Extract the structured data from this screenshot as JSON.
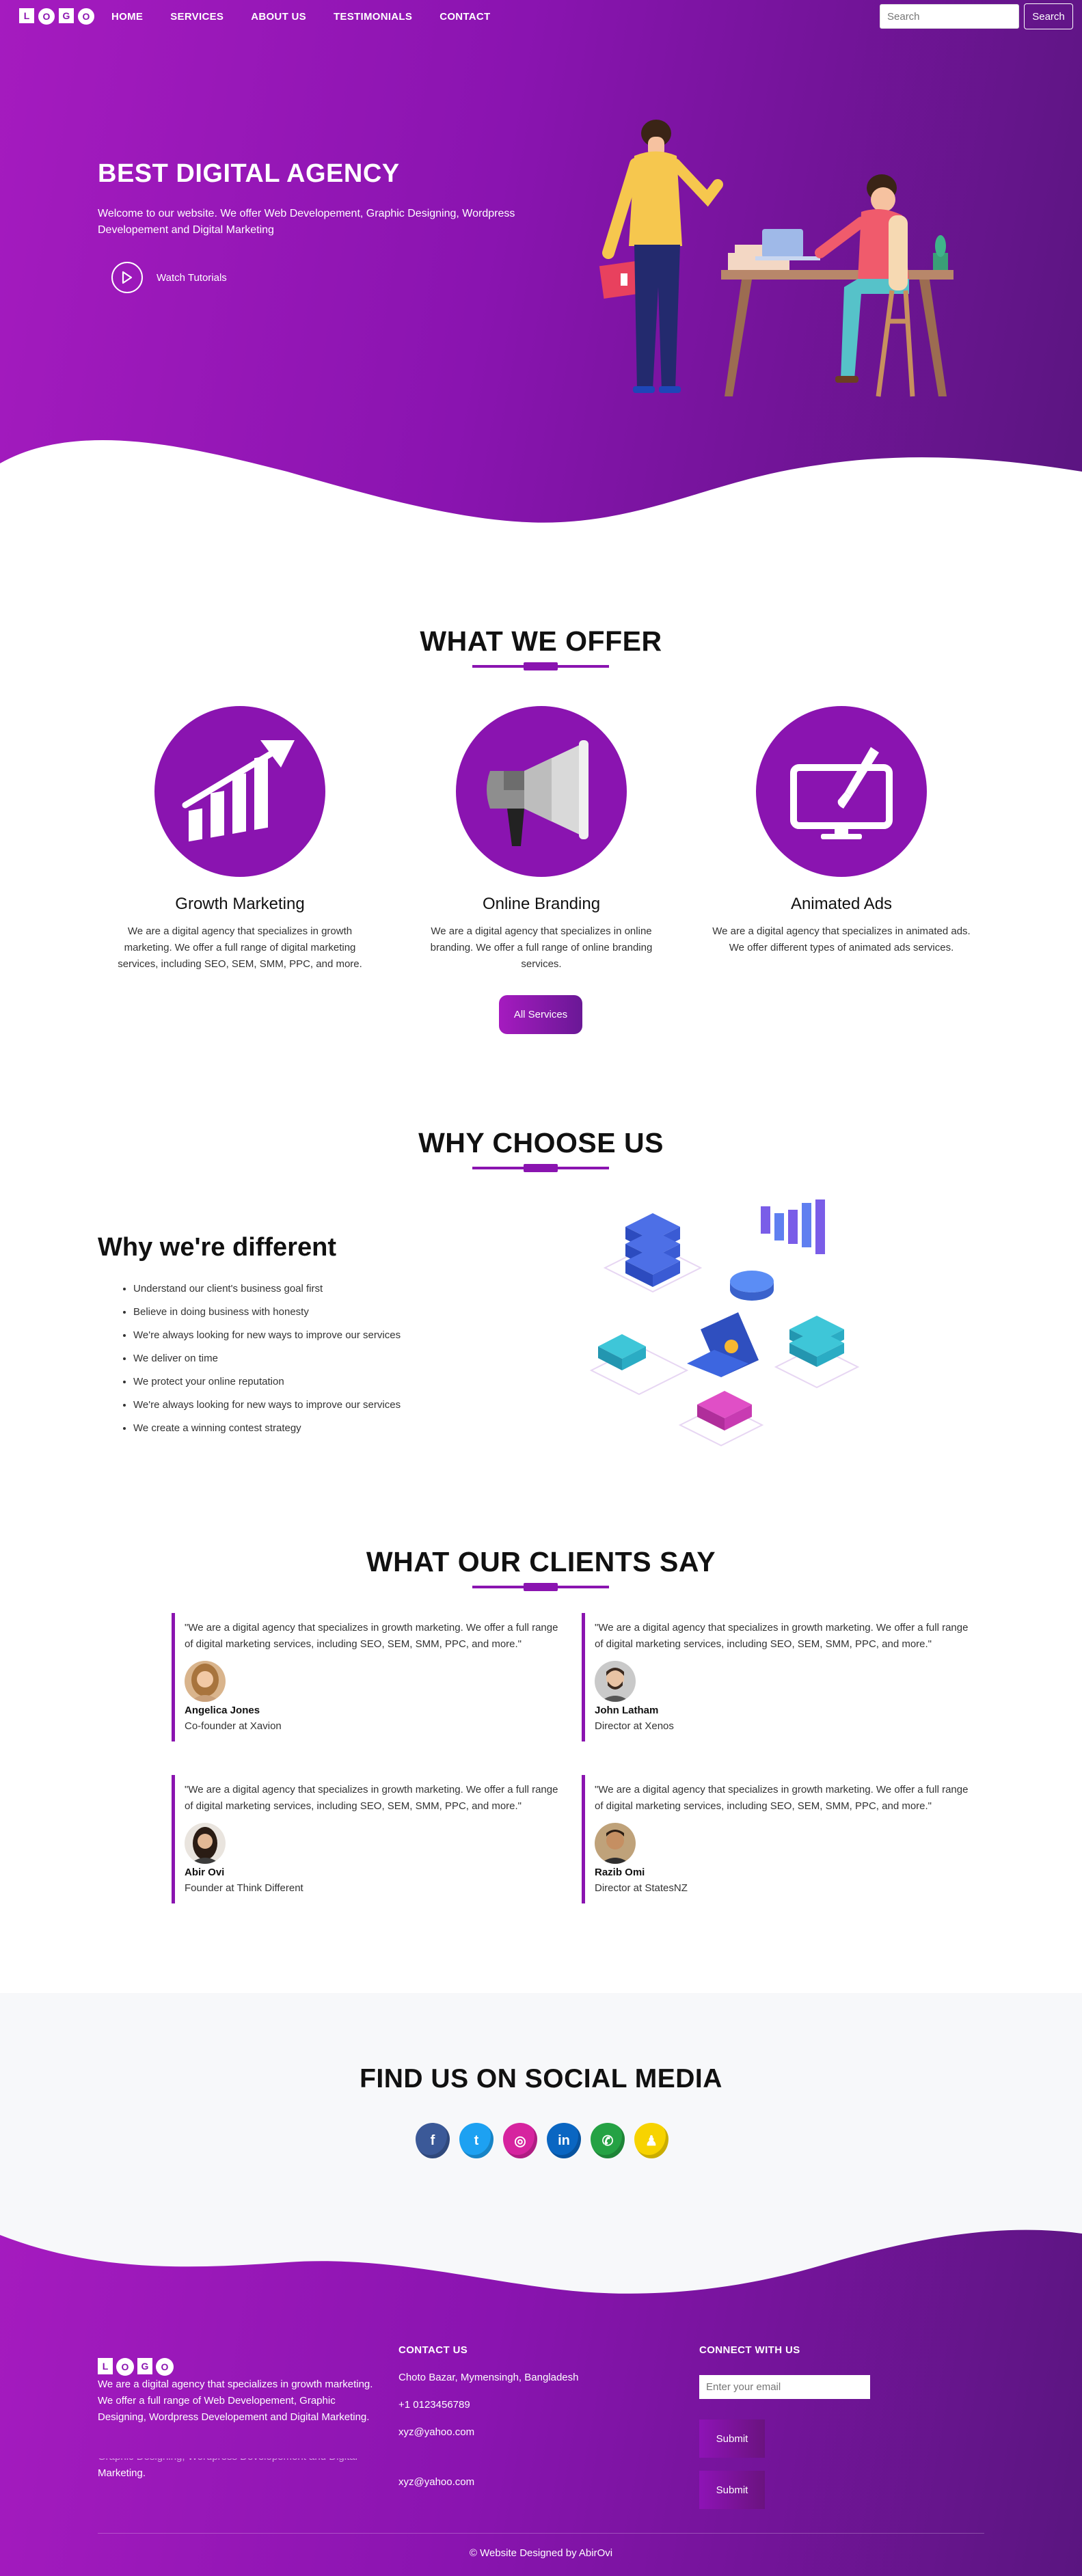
{
  "nav": {
    "logo_letters": [
      "L",
      "O",
      "G",
      "O"
    ],
    "links": [
      "HOME",
      "SERVICES",
      "ABOUT US",
      "TESTIMONIALS",
      "CONTACT"
    ],
    "search_placeholder": "Search",
    "search_button": "Search"
  },
  "hero": {
    "title": "BEST DIGITAL AGENCY",
    "subtitle": "Welcome to our website. We offer Web Developement, Graphic Designing, Wordpress Developement and Digital Marketing",
    "watch_label": "Watch Tutorials"
  },
  "offer": {
    "title": "WHAT WE OFFER",
    "cards": [
      {
        "icon": "growth-chart-icon",
        "name": "Growth Marketing",
        "desc": "We are a digital agency that specializes in growth marketing. We offer a full range of digital marketing services, including SEO, SEM, SMM, PPC, and more."
      },
      {
        "icon": "megaphone-icon",
        "name": "Online Branding",
        "desc": "We are a digital agency that specializes in online branding. We offer a full range of online branding services."
      },
      {
        "icon": "monitor-brush-icon",
        "name": "Animated Ads",
        "desc": "We are a digital agency that specializes in animated ads. We offer different types of animated ads services."
      }
    ],
    "all_button": "All Services"
  },
  "why": {
    "title": "WHY CHOOSE US",
    "heading": "Why we're different",
    "items": [
      "Understand our client's business goal first",
      "Believe in doing business with honesty",
      "We're always looking for new ways to improve our services",
      "We deliver on time",
      "We protect your online reputation",
      "We're always looking for new ways to improve our services",
      "We create a winning contest strategy"
    ]
  },
  "clients": {
    "title": "WHAT OUR CLIENTS SAY",
    "testimonials": [
      {
        "quote": "\"We are a digital agency that specializes in growth marketing. We offer a full range of digital marketing services, including SEO, SEM, SMM, PPC, and more.\"",
        "name": "Angelica Jones",
        "role": "Co-founder at Xavion"
      },
      {
        "quote": "\"We are a digital agency that specializes in growth marketing. We offer a full range of digital marketing services, including SEO, SEM, SMM, PPC, and more.\"",
        "name": "John Latham",
        "role": "Director at Xenos"
      },
      {
        "quote": "\"We are a digital agency that specializes in growth marketing. We offer a full range of digital marketing services, including SEO, SEM, SMM, PPC, and more.\"",
        "name": "Abir Ovi",
        "role": "Founder at Think Different"
      },
      {
        "quote": "\"We are a digital agency that specializes in growth marketing. We offer a full range of digital marketing services, including SEO, SEM, SMM, PPC, and more.\"",
        "name": "Razib Omi",
        "role": "Director at StatesNZ"
      }
    ]
  },
  "social": {
    "title": "FIND US ON SOCIAL MEDIA",
    "icons": [
      {
        "name": "facebook-icon",
        "glyph": "f",
        "color": "#3b5998"
      },
      {
        "name": "twitter-icon",
        "glyph": "t",
        "color": "#1da1f2"
      },
      {
        "name": "instagram-icon",
        "glyph": "◎",
        "color": "#d6249f"
      },
      {
        "name": "linkedin-icon",
        "glyph": "in",
        "color": "#0a66c2"
      },
      {
        "name": "whatsapp-icon",
        "glyph": "✆",
        "color": "#25a244"
      },
      {
        "name": "snapchat-icon",
        "glyph": "♟",
        "color": "#f7d300"
      }
    ]
  },
  "footer": {
    "logo_letters": [
      "L",
      "O",
      "G",
      "O"
    ],
    "about": "We are a digital agency that specializes in growth marketing. We offer a full range of Web Developement, Graphic Designing, Wordpress Developement and Digital Marketing.",
    "about_ghost_1": "Graphic Designing, Wordpress Developement and Digital",
    "about_ghost_2": "Marketing.",
    "contact_title": "CONTACT US",
    "address": "Choto Bazar, Mymensingh, Bangladesh",
    "phone": "+1 0123456789",
    "email": "xyz@yahoo.com",
    "email_ghost": "xyz@yahoo.com",
    "connect_title": "CONNECT WITH US",
    "email_placeholder": "Enter your email",
    "submit": "Submit",
    "submit_ghost": "Submit",
    "copyright": "© Website Designed by AbirOvi"
  },
  "colors": {
    "brand_purple": "#8a14b0",
    "grad_start": "#a51bbf",
    "grad_end": "#5a1580"
  }
}
